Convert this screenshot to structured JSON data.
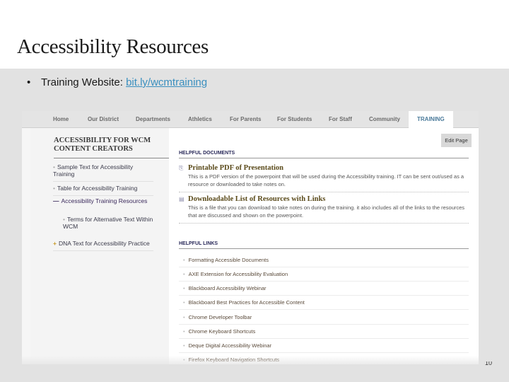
{
  "slide": {
    "title": "Accessibility Resources",
    "bullet_prefix": "Training Website: ",
    "bullet_link": "bit.ly/wcmtraining",
    "page_number": "10"
  },
  "website": {
    "nav": [
      "Home",
      "Our District",
      "Departments",
      "Athletics",
      "For Parents",
      "For Students",
      "For Staff",
      "Community",
      "TRAINING"
    ],
    "active_tab": "TRAINING",
    "sidebar": {
      "heading": "ACCESSIBILITY FOR WCM CONTENT CREATORS",
      "items": [
        {
          "marker": "•",
          "label": "Sample Text for Accessibility Training"
        },
        {
          "marker": "•",
          "label": "Table for Accessibility Training"
        },
        {
          "marker": "—",
          "label": "Accessibility Training Resources"
        },
        {
          "marker": "•",
          "label": "Terms for Alternative Text Within WCM"
        },
        {
          "marker": "+",
          "label": "DNA Text for Accessibility Practice"
        }
      ]
    },
    "edit_button": "Edit Page",
    "helpful_documents": {
      "heading": "HELPFUL DOCUMENTS",
      "items": [
        {
          "icon": "pdf-file-icon",
          "title": "Printable PDF of Presentation",
          "description": "This is a PDF version of the powerpoint that will be used during the Accessibility training. IT can be sent out/used as a resource or downloaded to take notes on."
        },
        {
          "icon": "doc-file-icon",
          "title": "Downloadable List of Resources with Links",
          "description": "This is a file that you can download to take notes on during the training. it also includes all of the links to the resources that are discussed and shown on the powerpoint."
        }
      ]
    },
    "helpful_links": {
      "heading": "HELPFUL LINKS",
      "items": [
        "Formatting Accessible Documents",
        "AXE Extension for Accessibility Evaluation",
        "Blackboard Accessibility Webinar",
        "Blackboard Best Practices for Accessible Content",
        "Chrome Developer Toolbar",
        "Chrome Keyboard Shortcuts",
        "Deque Digital Accessibility Webinar",
        "Firefox Keyboard Navigation Shortcuts"
      ]
    }
  }
}
